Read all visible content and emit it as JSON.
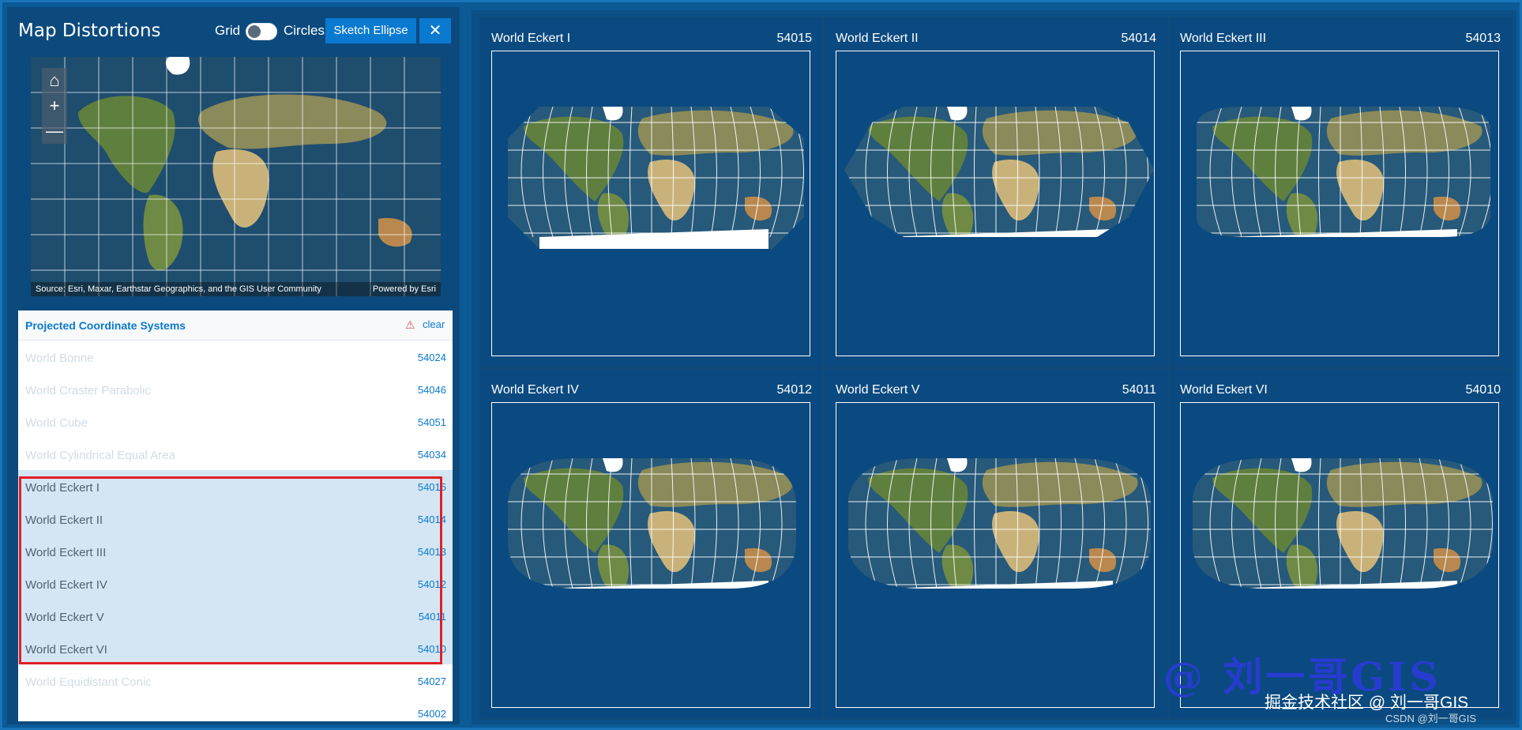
{
  "header": {
    "title": "Map Distortions",
    "grid_label": "Grid",
    "circles_label": "Circles",
    "sketch_button": "Sketch Ellipse",
    "close_button": "✕"
  },
  "overview_map": {
    "home_icon": "⌂",
    "zoom_in": "+",
    "zoom_out": "—",
    "attribution": "Source: Esri, Maxar, Earthstar Geographics, and the GIS User Community",
    "powered_by": "Powered by Esri"
  },
  "list": {
    "title": "Projected Coordinate Systems",
    "clear": "clear",
    "items": [
      {
        "name": "World Bonne",
        "code": "54024"
      },
      {
        "name": "World Craster Parabolic",
        "code": "54046"
      },
      {
        "name": "World Cube",
        "code": "54051"
      },
      {
        "name": "World Cylindrical Equal Area",
        "code": "54034"
      },
      {
        "name": "World Eckert I",
        "code": "54015"
      },
      {
        "name": "World Eckert II",
        "code": "54014"
      },
      {
        "name": "World Eckert III",
        "code": "54013"
      },
      {
        "name": "World Eckert IV",
        "code": "54012"
      },
      {
        "name": "World Eckert V",
        "code": "54011"
      },
      {
        "name": "World Eckert VI",
        "code": "54010"
      },
      {
        "name": "World Equidistant Conic",
        "code": "54027"
      },
      {
        "name": "",
        "code": "54002"
      }
    ]
  },
  "maps": [
    {
      "title": "World Eckert I",
      "code": "54015"
    },
    {
      "title": "World Eckert II",
      "code": "54014"
    },
    {
      "title": "World Eckert III",
      "code": "54013"
    },
    {
      "title": "World Eckert IV",
      "code": "54012"
    },
    {
      "title": "World Eckert V",
      "code": "54011"
    },
    {
      "title": "World Eckert VI",
      "code": "54010"
    }
  ],
  "watermark": {
    "main": "@ 刘一哥GIS",
    "sub": "掘金技术社区 @ 刘一哥GIS",
    "credit": "CSDN @刘一哥GIS"
  },
  "colors": {
    "accent": "#0a79d0",
    "highlight": "#e01f26",
    "panel": "#0c4a7d",
    "ocean": "#123a5c"
  }
}
